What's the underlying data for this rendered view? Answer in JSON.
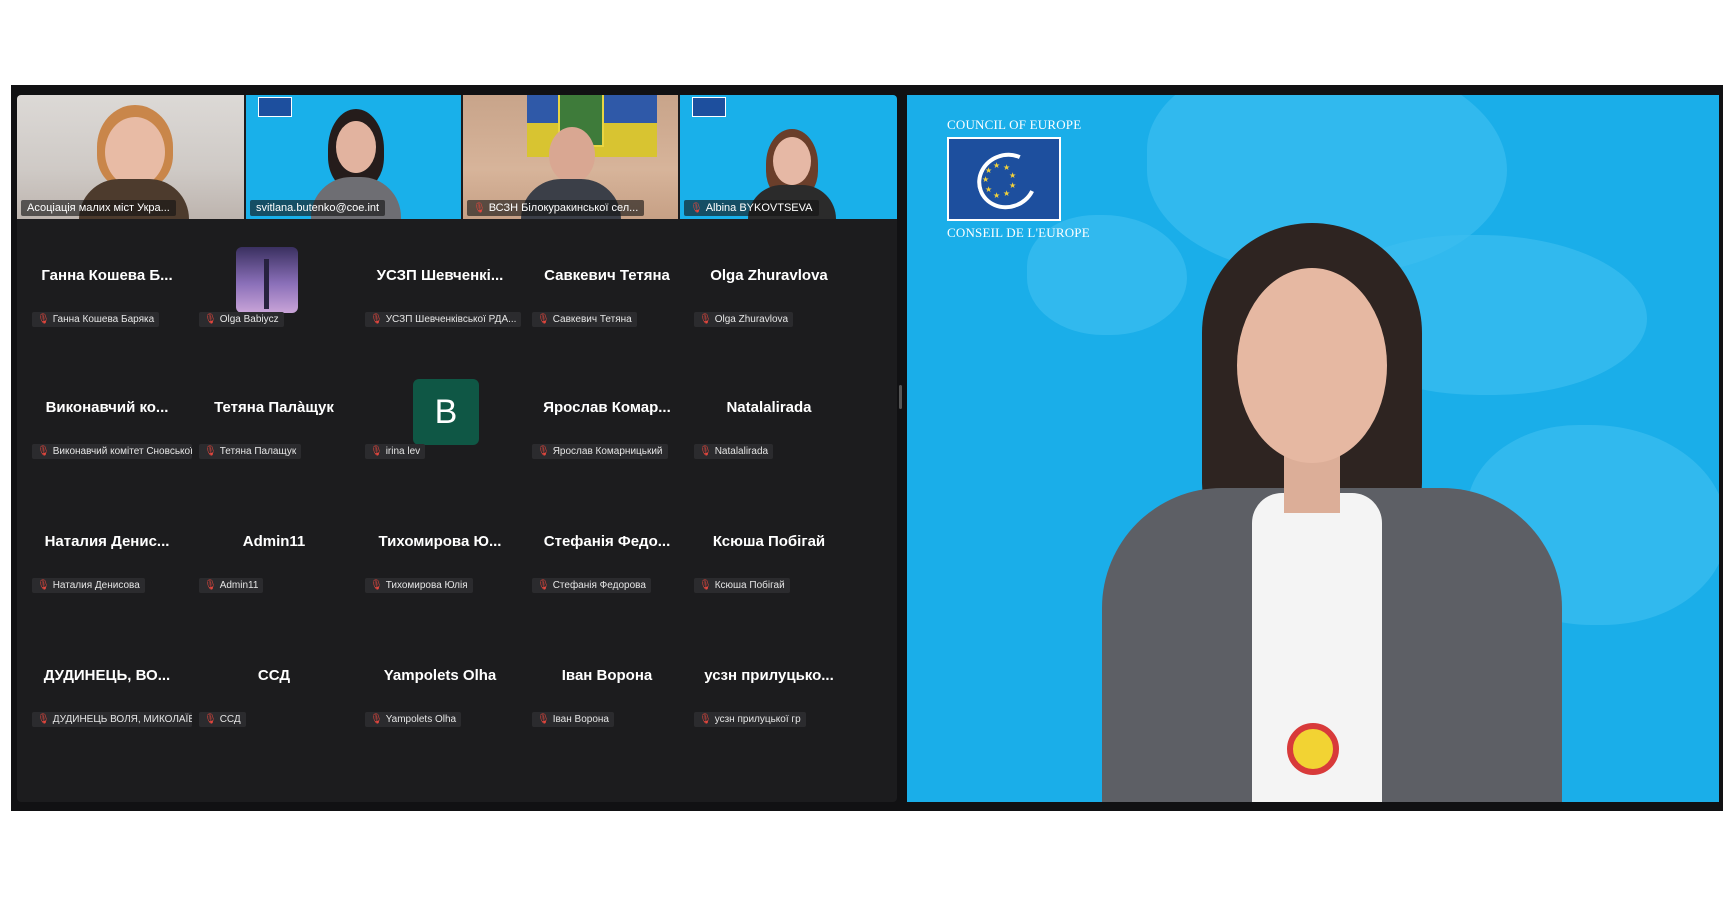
{
  "video_tiles": [
    {
      "name": "Асоціація малих міст Укра...",
      "muted": false
    },
    {
      "name": "svitlana.butenko@coe.int",
      "muted": false
    },
    {
      "name": "ВСЗН Білокуракинської сел...",
      "muted": true
    },
    {
      "name": "Albina BYKOVTSEVA",
      "muted": true
    }
  ],
  "participants": [
    {
      "display": "Ганна Кошева Б...",
      "label": "Ганна Кошева Баряка",
      "avatar": "name"
    },
    {
      "display": "",
      "label": "Olga Babiycz",
      "avatar": "image"
    },
    {
      "display": "УСЗП Шевченкі...",
      "label": "УСЗП Шевченківської РДА...",
      "avatar": "name"
    },
    {
      "display": "Савкевич Тетяна",
      "label": "Савкевич Тетяна",
      "avatar": "name"
    },
    {
      "display": "Olga Zhuravlova",
      "label": "Olga Zhuravlova",
      "avatar": "name"
    },
    {
      "display": "Виконавчий ко...",
      "label": "Виконавчий комітет Сновської с...",
      "avatar": "name"
    },
    {
      "display": "Тетяна Палàщук",
      "label": "Тетяна Палащук",
      "avatar": "name"
    },
    {
      "display": "B",
      "label": "irina lev",
      "avatar": "letter"
    },
    {
      "display": "Ярослав Комар...",
      "label": "Ярослав Комарницький",
      "avatar": "name"
    },
    {
      "display": "Natalalirada",
      "label": "Natalalirada",
      "avatar": "name"
    },
    {
      "display": "Наталия Денис...",
      "label": "Наталия Денисова",
      "avatar": "name"
    },
    {
      "display": "Admin11",
      "label": "Admin11",
      "avatar": "name"
    },
    {
      "display": "Тихомирова Ю...",
      "label": "Тихомирова Юлія",
      "avatar": "name"
    },
    {
      "display": "Стефанія Федо...",
      "label": "Стефанія Федорова",
      "avatar": "name"
    },
    {
      "display": "Ксюша Побігай",
      "label": "Ксюша Побігай",
      "avatar": "name"
    },
    {
      "display": "ДУДИНЕЦЬ, ВО...",
      "label": "ДУДИНЕЦЬ ВОЛЯ, МИКОЛАЇВ...",
      "avatar": "name"
    },
    {
      "display": "ССД",
      "label": "ССД",
      "avatar": "name"
    },
    {
      "display": "Yampolets Olha",
      "label": "Yampolets Olha",
      "avatar": "name"
    },
    {
      "display": "Іван Ворона",
      "label": "Іван Ворона",
      "avatar": "name"
    },
    {
      "display": "усзн прилуцько...",
      "label": "усзн прилуцької гр",
      "avatar": "name"
    }
  ],
  "speaker": {
    "org_top": "COUNCIL OF EUROPE",
    "org_bottom": "CONSEIL DE L'EUROPE"
  },
  "icons": {
    "mic_muted": "🎙",
    "coe_logo": "coe-logo-icon"
  },
  "colors": {
    "speaker_bg": "#1aaee9",
    "window_bg": "#111113",
    "muted_red": "#e0463d",
    "letter_avatar": "#0f5745"
  }
}
